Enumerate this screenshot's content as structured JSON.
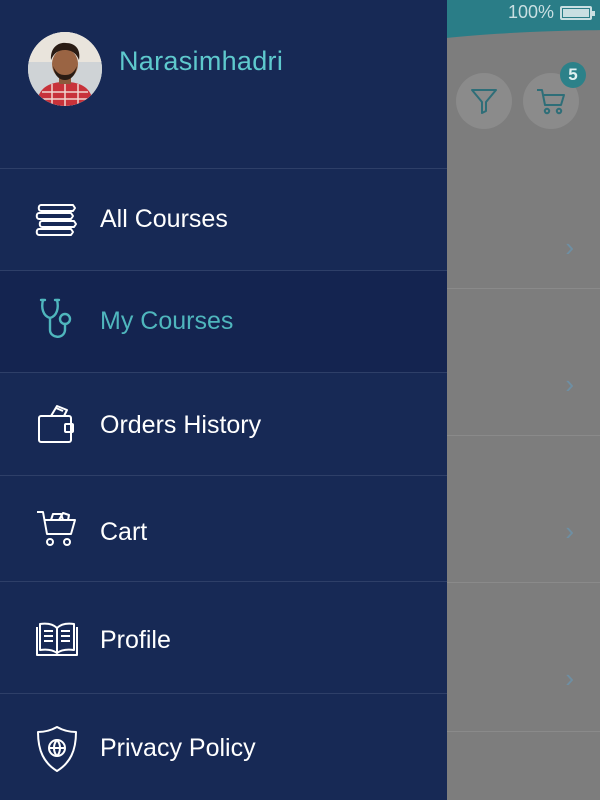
{
  "status_bar": {
    "battery_text": "100%"
  },
  "background": {
    "cart_badge_count": "5",
    "row_chevrons": [
      "›",
      "›",
      "›",
      "›"
    ]
  },
  "drawer": {
    "user_name": "Narasimhadri",
    "items": [
      {
        "label": "All Courses",
        "icon": "books-icon",
        "active": false
      },
      {
        "label": "My Courses",
        "icon": "stethoscope-icon",
        "active": true
      },
      {
        "label": "Orders History",
        "icon": "wallet-icon",
        "active": false
      },
      {
        "label": "Cart",
        "icon": "cart-icon",
        "active": false
      },
      {
        "label": "Profile",
        "icon": "open-book-icon",
        "active": false
      },
      {
        "label": "Privacy Policy",
        "icon": "shield-globe-icon",
        "active": false
      }
    ]
  },
  "colors": {
    "drawer_bg": "#172955",
    "accent": "#5ec9cd",
    "active_label": "#4fb6bd",
    "header_teal": "#2a7d87"
  }
}
